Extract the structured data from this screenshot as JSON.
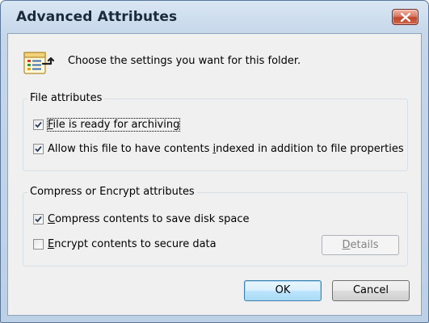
{
  "window": {
    "title": "Advanced Attributes"
  },
  "header": {
    "text": "Choose the settings you want for this folder."
  },
  "file_attributes": {
    "title": "File attributes",
    "options": [
      {
        "label_mnemonic": "F",
        "label_rest": "ile is ready for archiving",
        "checked": true
      },
      {
        "label_pre": "Allow this file to have contents ",
        "label_mnemonic": "i",
        "label_rest": "ndexed in addition to file properties",
        "checked": true
      }
    ]
  },
  "compress_encrypt": {
    "title": "Compress or Encrypt attributes",
    "options": [
      {
        "label_mnemonic": "C",
        "label_rest": "ompress contents to save disk space",
        "checked": true
      },
      {
        "label_mnemonic": "E",
        "label_rest": "ncrypt contents to secure data",
        "checked": false
      }
    ],
    "details_mnemonic": "D",
    "details_rest": "etails"
  },
  "buttons": {
    "ok": "OK",
    "cancel": "Cancel"
  },
  "colors": {
    "title_bar": "#c6d7ea",
    "close_button": "#c0452c",
    "dialog_background": "#f0f0f0",
    "default_button_border": "#3c7fb1"
  },
  "icons": {
    "header": "folder-properties-icon",
    "close": "close-x-icon",
    "check": "checkmark-icon"
  }
}
